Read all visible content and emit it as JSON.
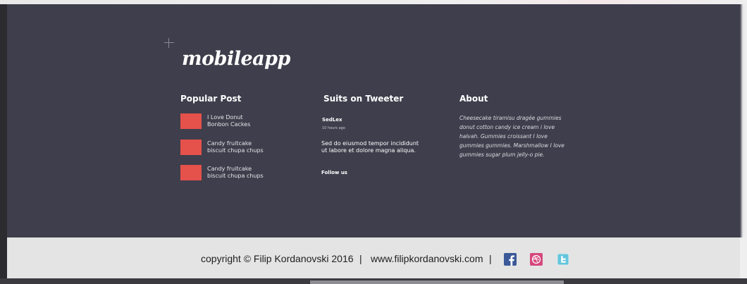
{
  "brand": {
    "logo_text": "mobileapp"
  },
  "popular_post": {
    "title": "Popular Post",
    "items": [
      {
        "line1": "I Love Donut",
        "line2": "Bonbon Cackes"
      },
      {
        "line1": "Candy fruitcake",
        "line2": "biscuit chupa chups"
      },
      {
        "line1": "Candy fruitcake",
        "line2": "biscuit chupa chups"
      }
    ]
  },
  "tweets": {
    "title": "Suits on Tweeter",
    "user": "SedLex",
    "time": "10 hours ago",
    "text": "Sed do eiusmod tempor incididunt ut labore et dolore magna aliqua.",
    "follow_label": "Follow us"
  },
  "about": {
    "title": "About",
    "text": "Cheesecake tiramisu dragée gummies donut cotton candy ice cream i love halvah. Gummies croissant I love gummies gummies. Marshmallow I love gummies sugar plum jelly-o pie."
  },
  "copyright": {
    "text": "copyright © Filip Kordanovski 2016",
    "separator": "|",
    "website": "www.filipkordanovski.com"
  },
  "social": {
    "icons": [
      "facebook-icon",
      "dribbble-icon",
      "twitter-icon"
    ]
  },
  "colors": {
    "footer_bg": "#3f3e4c",
    "accent": "#e5514b",
    "copyright_bg": "#e3e4e3"
  }
}
